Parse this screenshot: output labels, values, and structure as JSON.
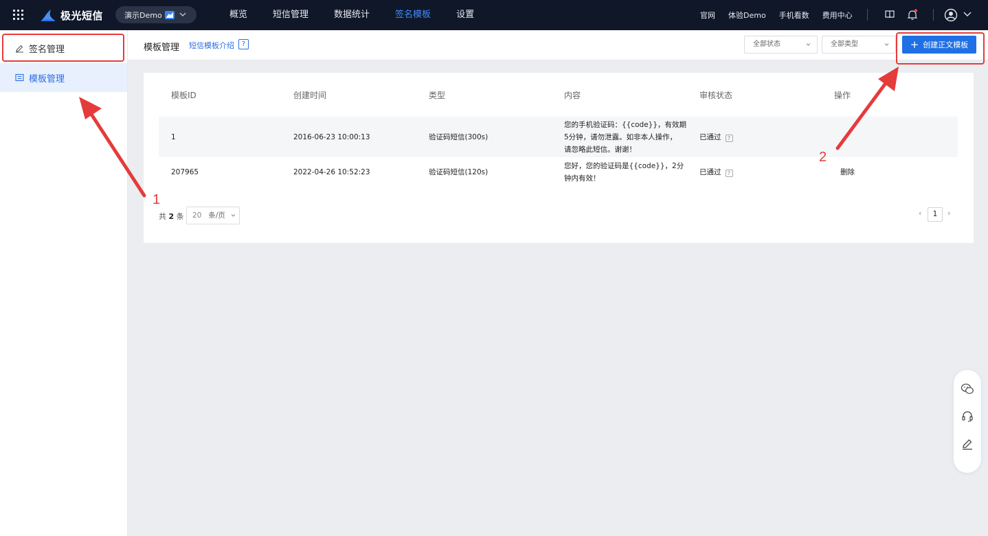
{
  "topbar": {
    "brand": "极光短信",
    "demo_label": "演示Demo",
    "nav": [
      {
        "label": "概览"
      },
      {
        "label": "短信管理"
      },
      {
        "label": "数据统计"
      },
      {
        "label": "签名模板",
        "active": true
      },
      {
        "label": "设置"
      }
    ],
    "links": [
      {
        "label": "官网"
      },
      {
        "label": "体验Demo"
      },
      {
        "label": "手机看数"
      },
      {
        "label": "费用中心"
      }
    ],
    "colors": {
      "bg": "#0f1729",
      "active": "#3f8cff"
    }
  },
  "sidebar": {
    "items": [
      {
        "label": "签名管理",
        "icon": "pen-icon"
      },
      {
        "label": "模板管理",
        "icon": "list-icon",
        "active": true
      }
    ]
  },
  "header": {
    "title": "模板管理",
    "intro_link": "短信模板介绍",
    "help": "?",
    "status_select": "全部状态",
    "type_select": "全部类型",
    "create_button": "创建正文模板"
  },
  "table": {
    "columns": [
      "模板ID",
      "创建时间",
      "类型",
      "内容",
      "审核状态",
      "操作"
    ],
    "rows": [
      {
        "id": "1",
        "created": "2016-06-23 10:00:13",
        "type": "验证码短信(300s)",
        "content_lines": [
          "您的手机验证码：{{code}}，有效期",
          "5分钟，请勿泄露。如非本人操作，",
          "请忽略此短信。谢谢！"
        ],
        "status": "已通过",
        "status_help": "?",
        "action": ""
      },
      {
        "id": "207965",
        "created": "2022-04-26 10:52:23",
        "type": "验证码短信(120s)",
        "content_lines": [
          "您好，您的验证码是{{code}}，2分",
          "钟内有效！"
        ],
        "status": "已通过",
        "status_help": "?",
        "action": "删除"
      }
    ]
  },
  "pagination": {
    "total_prefix": "共",
    "total_count": "2",
    "total_suffix": "条",
    "page_size": "20",
    "page_size_unit": "条/页",
    "current_page": "1",
    "prev": "‹",
    "next": "›"
  },
  "annotations": {
    "label_1": "1",
    "label_2": "2",
    "color": "#e53b3b"
  },
  "float_tools": [
    {
      "icon": "wechat-icon"
    },
    {
      "icon": "headset-icon"
    },
    {
      "icon": "edit-icon"
    }
  ]
}
